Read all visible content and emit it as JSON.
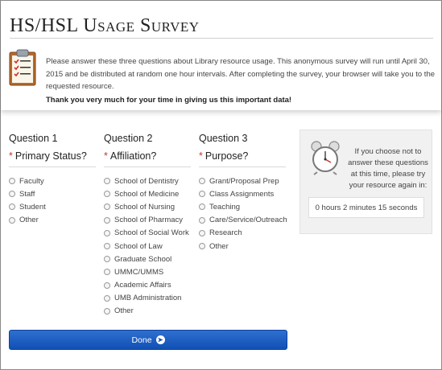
{
  "title": "HS/HSL Usage Survey",
  "intro": "Please answer these three questions about Library resource usage. This anonymous survey will run until April 30, 2015 and be distributed at random one hour intervals. After completing the survey, your browser will take you to the requested resource.",
  "thanks": "Thank you very much for your time in giving us this important data!",
  "questions": [
    {
      "number": "Question 1",
      "required_mark": "*",
      "label": "Primary Status?",
      "options": [
        "Faculty",
        "Staff",
        "Student",
        "Other"
      ]
    },
    {
      "number": "Question 2",
      "required_mark": "*",
      "label": "Affiliation?",
      "options": [
        "School of Dentistry",
        "School of Medicine",
        "School of Nursing",
        "School of Pharmacy",
        "School of Social Work",
        "School of Law",
        "Graduate School",
        "UMMC/UMMS",
        "Academic Affairs",
        "UMB Administration",
        "Other"
      ]
    },
    {
      "number": "Question 3",
      "required_mark": "*",
      "label": "Purpose?",
      "options": [
        "Grant/Proposal Prep",
        "Class Assignments",
        "Teaching",
        "Care/Service/Outreach",
        "Research",
        "Other"
      ]
    }
  ],
  "sidebar": {
    "message": "If you choose not to answer these questions at this time, please try your resource again in:",
    "timer": "0 hours 2 minutes 15 seconds"
  },
  "done_label": "Done",
  "icons": {
    "clipboard": "clipboard-icon",
    "clock": "alarm-clock-icon",
    "done": "arrow-right-circle-icon"
  },
  "colors": {
    "accent": "#1553b8",
    "required": "#c0392b"
  }
}
